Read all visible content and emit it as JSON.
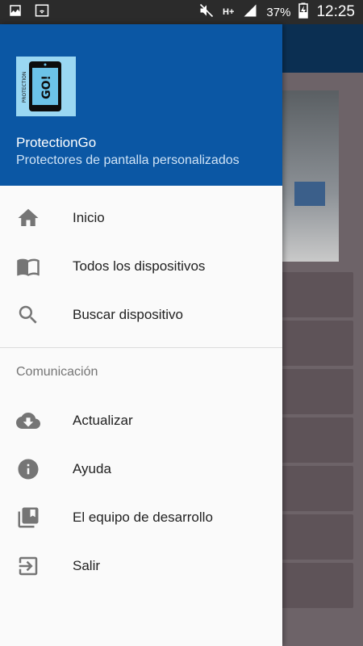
{
  "status_bar": {
    "icons": [
      "image-icon",
      "wifi-icon",
      "mute-icon",
      "network-hplus-icon",
      "signal-icon",
      "battery-charging-icon"
    ],
    "network": "H+",
    "battery": "37%",
    "time": "12:25"
  },
  "drawer": {
    "header": {
      "app_name": "ProtectionGo",
      "tagline": "Protectores de pantalla personalizados"
    },
    "items": [
      {
        "label": "Inicio",
        "icon": "home-icon"
      },
      {
        "label": "Todos los dispositivos",
        "icon": "book-icon"
      },
      {
        "label": "Buscar dispositivo",
        "icon": "search-icon"
      }
    ],
    "section_title": "Comunicación",
    "section_items": [
      {
        "label": "Actualizar",
        "icon": "cloud-download-icon"
      },
      {
        "label": "Ayuda",
        "icon": "info-icon"
      },
      {
        "label": "El equipo de desarrollo",
        "icon": "library-icon"
      },
      {
        "label": "Salir",
        "icon": "exit-icon"
      }
    ]
  },
  "colors": {
    "header": "#0b57a4",
    "drawer_bg": "#fafafa",
    "icon": "#757575"
  }
}
